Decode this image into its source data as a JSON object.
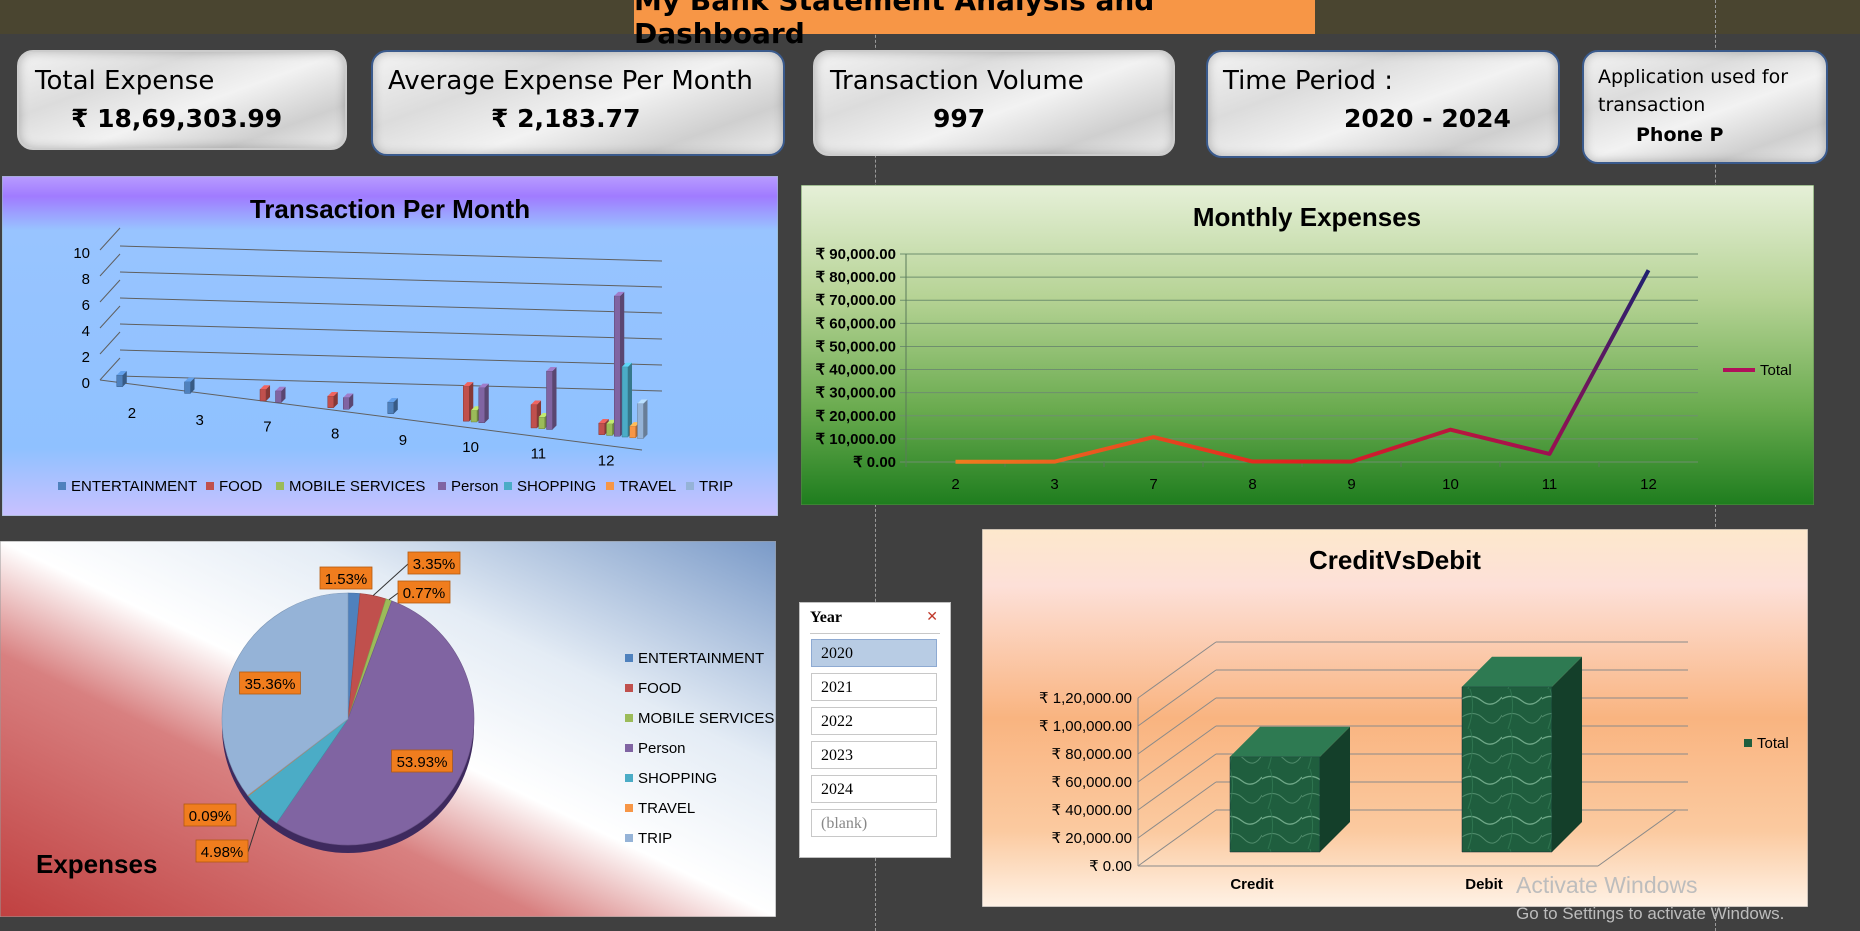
{
  "dashboard_title": "My Bank Statement Analysis and Dashboard",
  "kpis": {
    "total_expense": {
      "label": "Total Expense",
      "value": "₹ 18,69,303.99"
    },
    "avg_expense": {
      "label": "Average Expense Per Month",
      "value": "₹ 2,183.77"
    },
    "volume": {
      "label": "Transaction Volume",
      "value": "997"
    },
    "period": {
      "label": "Time Period :",
      "value": "2020 - 2024"
    },
    "app": {
      "label_line1": "Application used for",
      "label_line2": "transaction",
      "value": "Phone P"
    }
  },
  "slicer": {
    "title": "Year",
    "clear_icon": "clear-filter-icon",
    "items": [
      "2020",
      "2021",
      "2022",
      "2023",
      "2024",
      "(blank)"
    ],
    "selected": "2020"
  },
  "watermark": {
    "line1": "Activate Windows",
    "line2": "Go to Settings to activate Windows."
  },
  "colors": {
    "entertainment": "#4f81bd",
    "food": "#c0504d",
    "mobile": "#9bbb59",
    "person": "#8064a2",
    "shopping": "#4bacc6",
    "travel": "#f79646",
    "trip": "#95b3d7",
    "banner": "#f79646",
    "label_box": "#f07d1e"
  },
  "chart_data": [
    {
      "id": "transactions",
      "type": "bar",
      "title": "Transaction Per Month",
      "categories": [
        "2",
        "3",
        "7",
        "8",
        "9",
        "10",
        "11",
        "12"
      ],
      "ylim": [
        0,
        10
      ],
      "yticks": [
        "0",
        "2",
        "4",
        "6",
        "8",
        "10"
      ],
      "legend_position": "bottom",
      "series": [
        {
          "name": "ENTERTAINMENT",
          "values": [
            1,
            1,
            0,
            0,
            1,
            0,
            0,
            0
          ]
        },
        {
          "name": "FOOD",
          "values": [
            0,
            0,
            1,
            1,
            0,
            3,
            2,
            1
          ]
        },
        {
          "name": "MOBILE SERVICES",
          "values": [
            0,
            0,
            0,
            0,
            0,
            1,
            1,
            1
          ]
        },
        {
          "name": "Person",
          "values": [
            0,
            0,
            1,
            1,
            0,
            3,
            5,
            12
          ]
        },
        {
          "name": "SHOPPING",
          "values": [
            0,
            0,
            0,
            0,
            0,
            0,
            0,
            6
          ]
        },
        {
          "name": "TRAVEL",
          "values": [
            0,
            0,
            0,
            0,
            0,
            0,
            0,
            1
          ]
        },
        {
          "name": "TRIP",
          "values": [
            0,
            0,
            0,
            0,
            0,
            0,
            0,
            3
          ]
        }
      ]
    },
    {
      "id": "monthly",
      "type": "line",
      "title": "Monthly Expenses",
      "categories": [
        "2",
        "3",
        "7",
        "8",
        "9",
        "10",
        "11",
        "12"
      ],
      "ylim": [
        0,
        90000
      ],
      "yticks": [
        "₹ 0.00",
        "₹ 10,000.00",
        "₹ 20,000.00",
        "₹ 30,000.00",
        "₹ 40,000.00",
        "₹ 50,000.00",
        "₹ 60,000.00",
        "₹ 70,000.00",
        "₹ 80,000.00",
        "₹ 90,000.00"
      ],
      "legend_position": "right",
      "series": [
        {
          "name": "Total",
          "values": [
            100,
            150,
            10800,
            200,
            150,
            14000,
            3500,
            83000
          ]
        }
      ]
    },
    {
      "id": "expenses",
      "type": "pie",
      "title": "Expenses",
      "legend_position": "right",
      "labels": [
        "ENTERTAINMENT",
        "FOOD",
        "MOBILE SERVICES",
        "Person",
        "SHOPPING",
        "TRAVEL",
        "TRIP"
      ],
      "values": [
        1.53,
        3.35,
        0.77,
        53.93,
        4.98,
        0.09,
        35.36
      ],
      "value_labels": [
        "1.53%",
        "3.35%",
        "0.77%",
        "53.93%",
        "4.98%",
        "0.09%",
        "35.36%"
      ]
    },
    {
      "id": "creditdebit",
      "type": "bar",
      "title": "CreditVsDebit",
      "categories": [
        "Credit",
        "Debit"
      ],
      "ylim": [
        0,
        120000
      ],
      "yticks": [
        "₹ 0.00",
        "₹ 20,000.00",
        "₹ 40,000.00",
        "₹ 60,000.00",
        "₹ 80,000.00",
        "₹ 1,00,000.00",
        "₹ 1,20,000.00"
      ],
      "legend_position": "right",
      "series": [
        {
          "name": "Total",
          "values": [
            68000,
            118000
          ]
        }
      ]
    }
  ]
}
